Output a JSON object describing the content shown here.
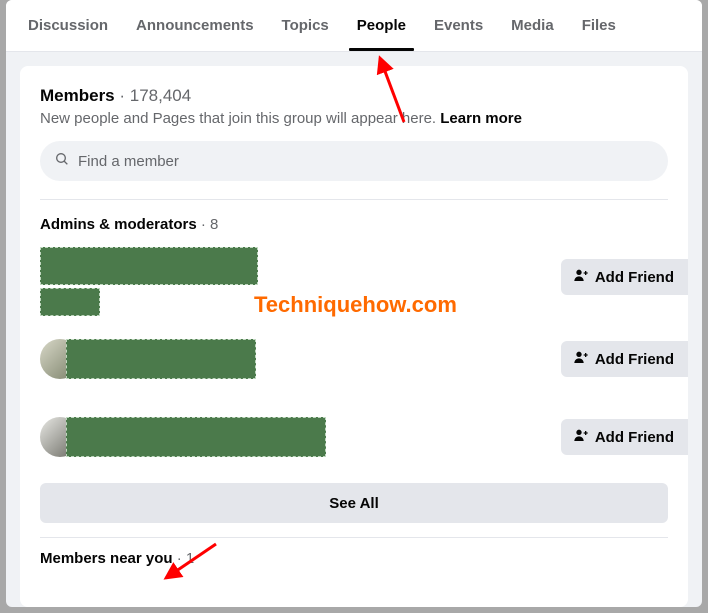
{
  "tabs": {
    "discussion": "Discussion",
    "announcements": "Announcements",
    "topics": "Topics",
    "people": "People",
    "events": "Events",
    "media": "Media",
    "files": "Files",
    "active": "people"
  },
  "members": {
    "title": "Members",
    "count": "178,404",
    "subtitle": "New people and Pages that join this group will appear here.",
    "learn_more": "Learn more"
  },
  "search": {
    "placeholder": "Find a member"
  },
  "admins": {
    "title": "Admins & moderators",
    "count": "8",
    "add_friend_label": "Add Friend",
    "see_all_label": "See All"
  },
  "near": {
    "title": "Members near you",
    "count": "1"
  },
  "watermark": "Techniquehow.com"
}
